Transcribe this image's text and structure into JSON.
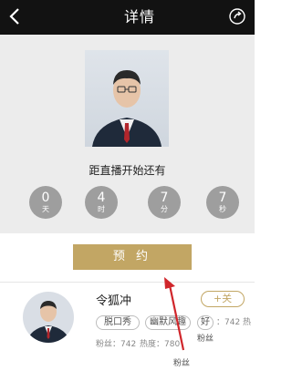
{
  "header": {
    "title": "详情",
    "back_icon": "back-chevron-icon",
    "share_icon": "share-icon"
  },
  "countdown": {
    "label": "距直播开始还有",
    "items": [
      {
        "value": "0",
        "unit": "天"
      },
      {
        "value": "4",
        "unit": "时"
      },
      {
        "value": "7",
        "unit": "分"
      },
      {
        "value": "7",
        "unit": "秒"
      }
    ]
  },
  "reserve_button": {
    "label": "预 约"
  },
  "host": {
    "name": "令狐冲",
    "follow_label": "+关",
    "tags": [
      "脱口秀",
      "幽默风趣",
      "好"
    ],
    "fans_stat": "粉丝：742",
    "heat_stat": "热度：780",
    "right_stat": "：742  热",
    "fans_caption": "粉丝"
  },
  "bottom_caption": "粉丝",
  "colors": {
    "topbar": "#121212",
    "accent_gold": "#c2a664",
    "circle_gray": "#9e9e9e",
    "arrow_red": "#d0262b"
  }
}
